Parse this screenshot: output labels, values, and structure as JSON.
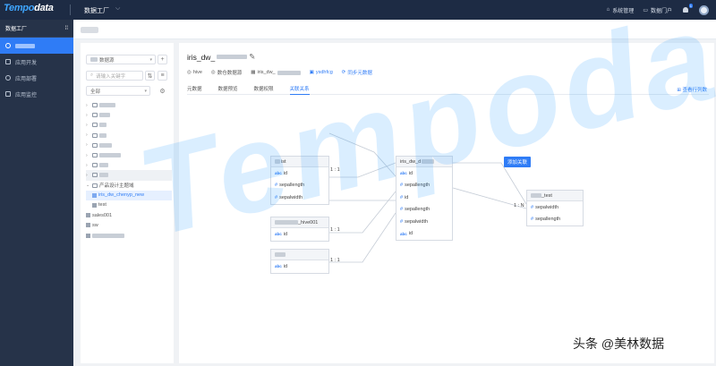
{
  "topbar": {
    "logo_prefix": "Tempo",
    "logo_suffix": "data",
    "module": "数据工厂",
    "chevron": "⌵",
    "right_items": [
      "系统管理",
      "数据门户"
    ],
    "notification_count": "1"
  },
  "sidebar": {
    "header": "数据工厂",
    "items": [
      "",
      "应用开发",
      "应用部署",
      "应用监控"
    ]
  },
  "left_panel": {
    "source_select": "数据源",
    "search_placeholder": "请输入关键字",
    "filter_select": "全部",
    "tree": [
      {
        "label": "",
        "type": "folder",
        "expanded": false
      },
      {
        "label": "",
        "type": "folder",
        "expanded": false
      },
      {
        "label": "",
        "type": "folder",
        "expanded": false
      },
      {
        "label": "",
        "type": "folder",
        "expanded": false
      },
      {
        "label": "",
        "type": "folder",
        "expanded": false
      },
      {
        "label": "",
        "type": "folder",
        "expanded": false
      },
      {
        "label": "",
        "type": "folder",
        "expanded": false
      },
      {
        "label": "",
        "type": "folder",
        "expanded": false
      },
      {
        "label": "产品设计主题域",
        "type": "folder",
        "expanded": true
      },
      {
        "label": "iris_dw_chenyp_new",
        "type": "table",
        "selected": true
      },
      {
        "label": "test",
        "type": "table"
      },
      {
        "label": "sales001",
        "type": "table"
      },
      {
        "label": "sw",
        "type": "table"
      },
      {
        "label": "",
        "type": "table"
      }
    ]
  },
  "main": {
    "title": "iris_dw_",
    "meta": [
      "hive",
      "数仓数据源",
      "iris_dw_",
      "ysdhfcg",
      "同步元数据"
    ],
    "tabs": [
      "元数据",
      "数据预览",
      "数据权限",
      "关联关系"
    ],
    "active_tab": "关联关系",
    "view_link": "查看行列数"
  },
  "er": {
    "entities": [
      {
        "title": "ist",
        "fields": [
          {
            "n": "id",
            "k": "abc"
          },
          {
            "n": "sepallength",
            "k": "#"
          },
          {
            "n": "sepalwidth",
            "k": "#"
          }
        ]
      },
      {
        "title": "_hive001",
        "fields": [
          {
            "n": "id",
            "k": "abc"
          }
        ]
      },
      {
        "title": "",
        "fields": [
          {
            "n": "id",
            "k": "abc"
          }
        ]
      },
      {
        "title": "iris_dw_d",
        "fields": [
          {
            "n": "id",
            "k": "abc"
          },
          {
            "n": "sepallength",
            "k": "#"
          },
          {
            "n": "id",
            "k": "#"
          },
          {
            "n": "sepallength",
            "k": "#"
          },
          {
            "n": "sepalwidth",
            "k": "#"
          },
          {
            "n": "id",
            "k": "abc"
          }
        ]
      },
      {
        "title": "_test",
        "fields": [
          {
            "n": "sepalwidth",
            "k": "#"
          },
          {
            "n": "sepallength",
            "k": "#"
          }
        ]
      }
    ],
    "relations": [
      "1 : 1",
      "1 : 1",
      "1 : 1",
      "1 : N"
    ],
    "add_button": "添加关联"
  },
  "watermark": "Tempodata",
  "credit": "头条 @美林数据"
}
